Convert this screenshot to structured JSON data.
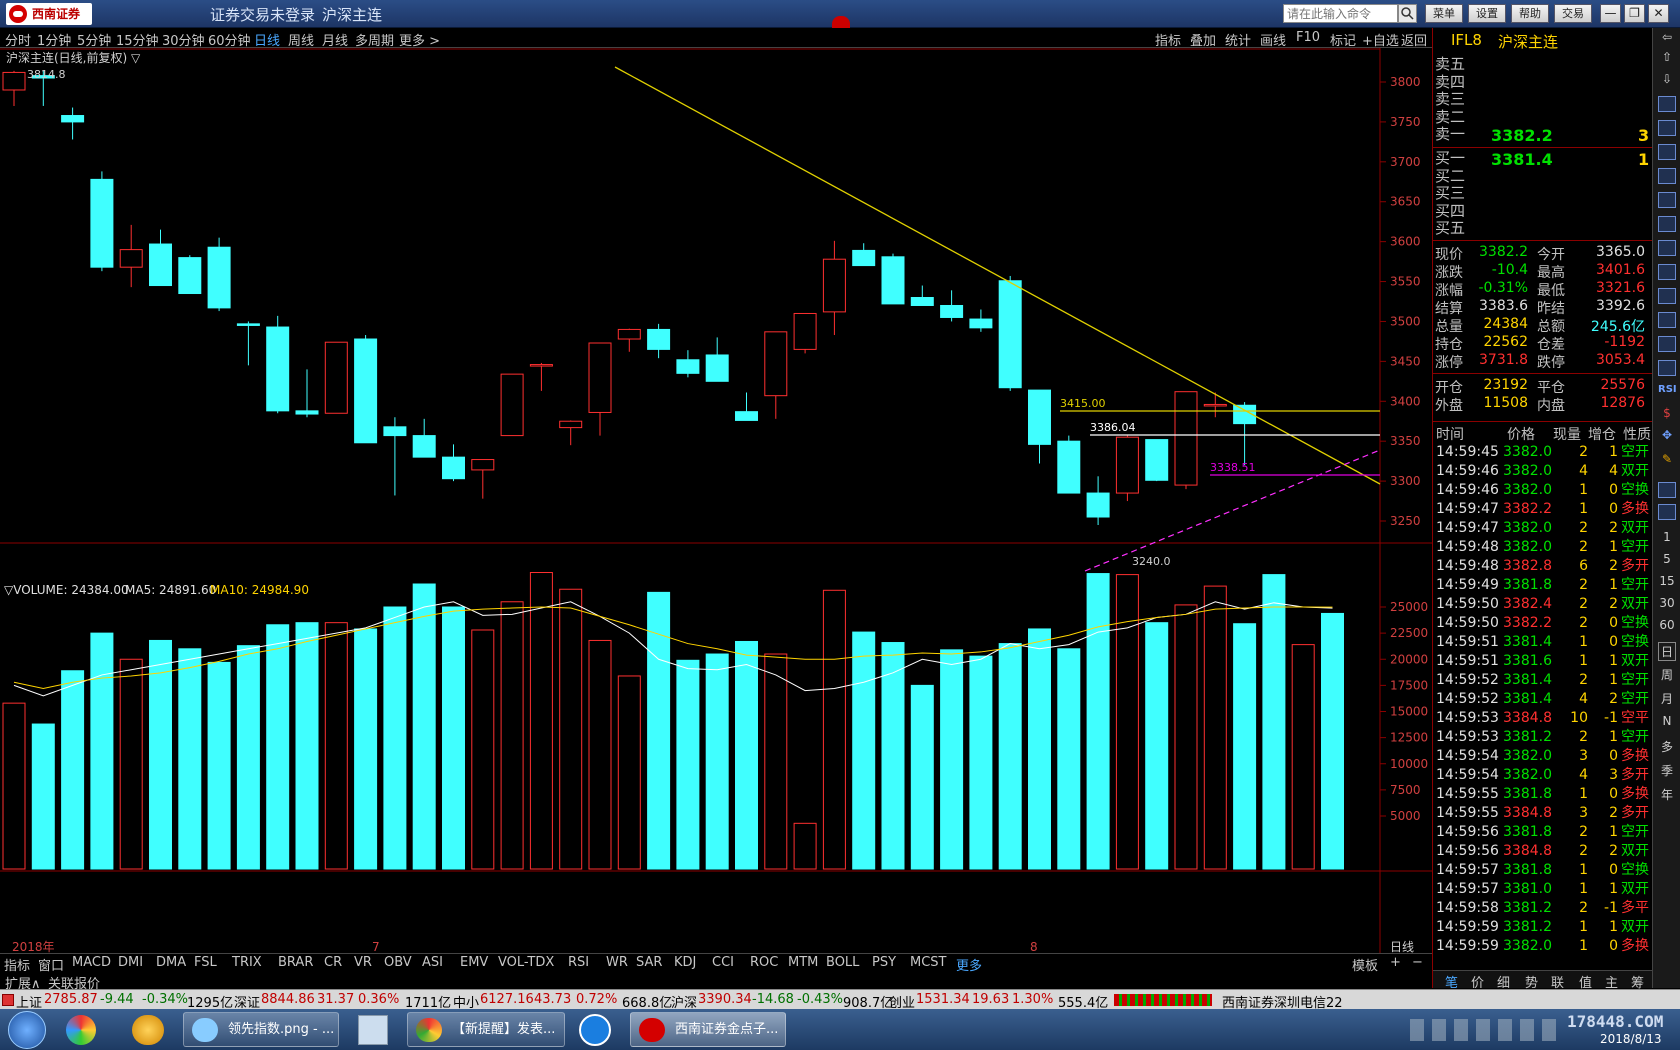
{
  "window": {
    "brand": "西南证券",
    "status": "证券交易未登录",
    "instrument": "沪深主连",
    "search_placeholder": "请在此输入命令",
    "menu_buttons": [
      "菜单",
      "设置",
      "帮助",
      "交易"
    ],
    "win_buttons": [
      "—",
      "❐",
      "✕"
    ]
  },
  "periods": [
    "分时",
    "1分钟",
    "5分钟",
    "15分钟",
    "30分钟",
    "60分钟",
    "日线",
    "周线",
    "月线",
    "多周期",
    "更多 >"
  ],
  "active_period": "日线",
  "tools": [
    "指标",
    "叠加",
    "统计",
    "画线",
    "F10",
    "标记",
    "+自选",
    "返回"
  ],
  "chart_title": "沪深主连(日线,前复权) ▽",
  "volume_header": {
    "label": "▽VOLUME: 24384.00",
    "ma5": "MA5: 24891.60",
    "ma10": "MA10: 24984.90"
  },
  "annotations": {
    "high": "3814.8",
    "low": "3240.0",
    "l1": "3415.00",
    "l2": "3386.04",
    "l3": "3338.51"
  },
  "bottom_axis": {
    "year": "2018年",
    "m7": "7",
    "m8": "8",
    "period": "日线"
  },
  "chart_data": {
    "type": "candlestick",
    "price_ticks": [
      3800,
      3750,
      3700,
      3650,
      3600,
      3550,
      3500,
      3450,
      3400,
      3350,
      3300,
      3250
    ],
    "volume_ticks": [
      25000,
      22500,
      20000,
      17500,
      15000,
      12500,
      10000,
      7500,
      5000
    ],
    "candles": [
      [
        3790,
        3814,
        3770,
        3812
      ],
      [
        3808,
        3814,
        3770,
        3805
      ],
      [
        3758,
        3768,
        3728,
        3750
      ],
      [
        3678,
        3688,
        3563,
        3568
      ],
      [
        3568,
        3621,
        3543,
        3590
      ],
      [
        3597,
        3615,
        3545,
        3545
      ],
      [
        3580,
        3583,
        3535,
        3535
      ],
      [
        3593,
        3605,
        3513,
        3517
      ],
      [
        3497,
        3500,
        3445,
        3495
      ],
      [
        3493,
        3507,
        3385,
        3388
      ],
      [
        3388,
        3440,
        3380,
        3384
      ],
      [
        3385,
        3474,
        3385,
        3474
      ],
      [
        3478,
        3483,
        3352,
        3348
      ],
      [
        3368,
        3380,
        3282,
        3357
      ],
      [
        3357,
        3378,
        3331,
        3330
      ],
      [
        3330,
        3346,
        3300,
        3303
      ],
      [
        3314,
        3323,
        3278,
        3327
      ],
      [
        3357,
        3418,
        3357,
        3434
      ],
      [
        3445,
        3448,
        3413,
        3446
      ],
      [
        3367,
        3376,
        3345,
        3375
      ],
      [
        3386,
        3392,
        3357,
        3473
      ],
      [
        3478,
        3491,
        3462,
        3490
      ],
      [
        3490,
        3497,
        3454,
        3465
      ],
      [
        3452,
        3464,
        3430,
        3435
      ],
      [
        3458,
        3480,
        3426,
        3425
      ],
      [
        3387,
        3411,
        3376,
        3376
      ],
      [
        3407,
        3475,
        3378,
        3487
      ],
      [
        3465,
        3508,
        3460,
        3510
      ],
      [
        3512,
        3601,
        3483,
        3578
      ],
      [
        3589,
        3598,
        3570,
        3570
      ],
      [
        3581,
        3585,
        3526,
        3522
      ],
      [
        3530,
        3545,
        3520,
        3520
      ],
      [
        3520,
        3539,
        3500,
        3505
      ],
      [
        3503,
        3515,
        3487,
        3492
      ],
      [
        3551,
        3557,
        3413,
        3417
      ],
      [
        3414,
        3414,
        3322,
        3346
      ],
      [
        3350,
        3357,
        3288,
        3285
      ],
      [
        3285,
        3306,
        3245,
        3255
      ],
      [
        3285,
        3357,
        3275,
        3355
      ],
      [
        3352,
        3352,
        3300,
        3301
      ],
      [
        3295,
        3409,
        3290,
        3412
      ],
      [
        3395,
        3411,
        3380,
        3396
      ],
      [
        3395,
        3399,
        3320,
        3372
      ]
    ],
    "volume": [
      15800,
      13800,
      18900,
      22500,
      20000,
      21800,
      21000,
      19700,
      21300,
      23300,
      23500,
      23500,
      22900,
      25000,
      27200,
      25000,
      22800,
      25500,
      28300,
      26700,
      21800,
      18400,
      26400,
      19900,
      20500,
      21700,
      20500,
      4300,
      26600,
      22600,
      21600,
      17500,
      20900,
      20300,
      21500,
      22900,
      21000,
      28200,
      28100,
      23500,
      25200,
      27000,
      23400,
      28100,
      21400,
      24384
    ],
    "ma5": [
      17500,
      16500,
      17500,
      18500,
      19000,
      19500,
      20000,
      20500,
      21000,
      21500,
      22000,
      22500,
      23000,
      24000,
      25000,
      25500,
      24200,
      24300,
      24900,
      25500,
      24100,
      22500,
      20000,
      19100,
      19000,
      19500,
      18500,
      17000,
      17200,
      17800,
      18700,
      20000,
      19500,
      20000,
      21500,
      21000,
      21400,
      22600,
      23000,
      24000,
      24300,
      25500,
      24800,
      25400,
      25000,
      24891
    ],
    "ma10": [
      17800,
      17200,
      17800,
      18200,
      18400,
      18700,
      19200,
      19800,
      20500,
      21000,
      21700,
      22300,
      22900,
      23500,
      24100,
      24600,
      24800,
      24900,
      25000,
      24900,
      24100,
      23300,
      22400,
      21500,
      21000,
      20400,
      20200,
      20000,
      20000,
      20300,
      20400,
      20600,
      20500,
      20700,
      21100,
      21700,
      22300,
      23100,
      23600,
      24000,
      24300,
      24800,
      24900,
      25000,
      25000,
      24984
    ]
  },
  "quote": {
    "code": "IFL8",
    "name": "沪深主连",
    "sells": [
      "卖五",
      "卖四",
      "卖三",
      "卖二",
      "卖一"
    ],
    "sell1_price": "3382.2",
    "sell1_vol": "3",
    "buys": [
      "买一",
      "买二",
      "买三",
      "买四",
      "买五"
    ],
    "buy1_price": "3381.4",
    "buy1_vol": "1",
    "stats": [
      [
        "现价",
        "3382.2",
        "今开",
        "3365.0"
      ],
      [
        "涨跌",
        "-10.4",
        "最高",
        "3401.6"
      ],
      [
        "涨幅",
        "-0.31%",
        "最低",
        "3321.6"
      ],
      [
        "结算",
        "3383.6",
        "昨结",
        "3392.6"
      ],
      [
        "总量",
        "24384",
        "总额",
        "245.6亿"
      ],
      [
        "持仓",
        "22562",
        "仓差",
        "-1192"
      ],
      [
        "涨停",
        "3731.8",
        "跌停",
        "3053.4"
      ]
    ],
    "stats2": [
      [
        "开仓",
        "23192",
        "平仓",
        "25576"
      ],
      [
        "外盘",
        "11508",
        "内盘",
        "12876"
      ]
    ],
    "tick_header": [
      "时间",
      "价格",
      "现量",
      "增仓",
      "性质"
    ],
    "ticks": [
      [
        "14:59:45",
        "3382.0",
        "2",
        "1",
        "空开"
      ],
      [
        "14:59:46",
        "3382.0",
        "4",
        "4",
        "双开"
      ],
      [
        "14:59:46",
        "3382.0",
        "1",
        "0",
        "空换"
      ],
      [
        "14:59:47",
        "3382.2",
        "1",
        "0",
        "多换"
      ],
      [
        "14:59:47",
        "3382.0",
        "2",
        "2",
        "双开"
      ],
      [
        "14:59:48",
        "3382.0",
        "2",
        "1",
        "空开"
      ],
      [
        "14:59:48",
        "3382.8",
        "6",
        "2",
        "多开"
      ],
      [
        "14:59:49",
        "3381.8",
        "2",
        "1",
        "空开"
      ],
      [
        "14:59:50",
        "3382.4",
        "2",
        "2",
        "双开"
      ],
      [
        "14:59:50",
        "3382.2",
        "2",
        "0",
        "空换"
      ],
      [
        "14:59:51",
        "3381.4",
        "1",
        "0",
        "空换"
      ],
      [
        "14:59:51",
        "3381.6",
        "1",
        "1",
        "双开"
      ],
      [
        "14:59:52",
        "3381.4",
        "2",
        "1",
        "空开"
      ],
      [
        "14:59:52",
        "3381.4",
        "4",
        "2",
        "空开"
      ],
      [
        "14:59:53",
        "3384.8",
        "10",
        "-1",
        "空平"
      ],
      [
        "14:59:53",
        "3381.2",
        "2",
        "1",
        "空开"
      ],
      [
        "14:59:54",
        "3382.0",
        "3",
        "0",
        "多换"
      ],
      [
        "14:59:54",
        "3382.0",
        "4",
        "3",
        "多开"
      ],
      [
        "14:59:55",
        "3381.8",
        "1",
        "0",
        "多换"
      ],
      [
        "14:59:55",
        "3384.8",
        "3",
        "2",
        "多开"
      ],
      [
        "14:59:56",
        "3381.8",
        "2",
        "1",
        "空开"
      ],
      [
        "14:59:56",
        "3384.8",
        "2",
        "2",
        "双开"
      ],
      [
        "14:59:57",
        "3381.8",
        "1",
        "0",
        "空换"
      ],
      [
        "14:59:57",
        "3381.0",
        "1",
        "1",
        "双开"
      ],
      [
        "14:59:58",
        "3381.2",
        "2",
        "-1",
        "多平"
      ],
      [
        "14:59:59",
        "3381.2",
        "1",
        "1",
        "双开"
      ],
      [
        "14:59:59",
        "3382.0",
        "1",
        "0",
        "多换"
      ]
    ],
    "bottom_tabs": [
      "笔",
      "价",
      "细",
      "势",
      "联",
      "值",
      "主",
      "筹"
    ]
  },
  "side_items": [
    "RSI",
    "1",
    "5",
    "15",
    "30",
    "60",
    "日",
    "周",
    "月",
    "N",
    "多",
    "季",
    "年"
  ],
  "indicators": [
    "指标",
    "窗口",
    "MACD",
    "DMI",
    "DMA",
    "FSL",
    "TRIX",
    "BRAR",
    "CR",
    "VR",
    "OBV",
    "ASI",
    "EMV",
    "VOL-TDX",
    "RSI",
    "WR",
    "SAR",
    "KDJ",
    "CCI",
    "ROC",
    "MTM",
    "BOLL",
    "PSY",
    "MCST",
    "更多"
  ],
  "ind_right": [
    "模板",
    "+",
    "−"
  ],
  "expand": [
    "扩展∧",
    "关联报价"
  ],
  "ticker": {
    "a": "上证",
    "a_v": "2785.87",
    "a_c": "-9.44",
    "a_p": "-0.34%",
    "a_amt": "1295亿",
    "b": "深证",
    "b_v": "8844.86",
    "b_c": "31.37",
    "b_p": "0.36%",
    "b_amt": "1711亿",
    "c": "中小",
    "c_v": "6127.16",
    "c_c": "43.73",
    "c_p": "0.72%",
    "c_amt": "668.8亿",
    "d": "沪深",
    "d_v": "3390.34",
    "d_c": "-14.68",
    "d_p": "-0.43%",
    "d_amt": "908.7亿",
    "e": "创业",
    "e_v": "1531.34",
    "e_c": "19.63",
    "e_p": "1.30%",
    "e_amt": "555.4亿",
    "server": "西南证券深圳电信22"
  },
  "taskbar": {
    "items": [
      "领先指数.png - ...",
      "",
      "【新提醒】发表...",
      "",
      "西南证券金点子..."
    ],
    "date": "2018/8/13",
    "watermark": "178448.COM"
  },
  "colors": {
    "up": "#ff3030",
    "down": "#40ffff",
    "ma5": "#ffffff",
    "ma10": "#ffd400",
    "grid": "#8b0000"
  }
}
